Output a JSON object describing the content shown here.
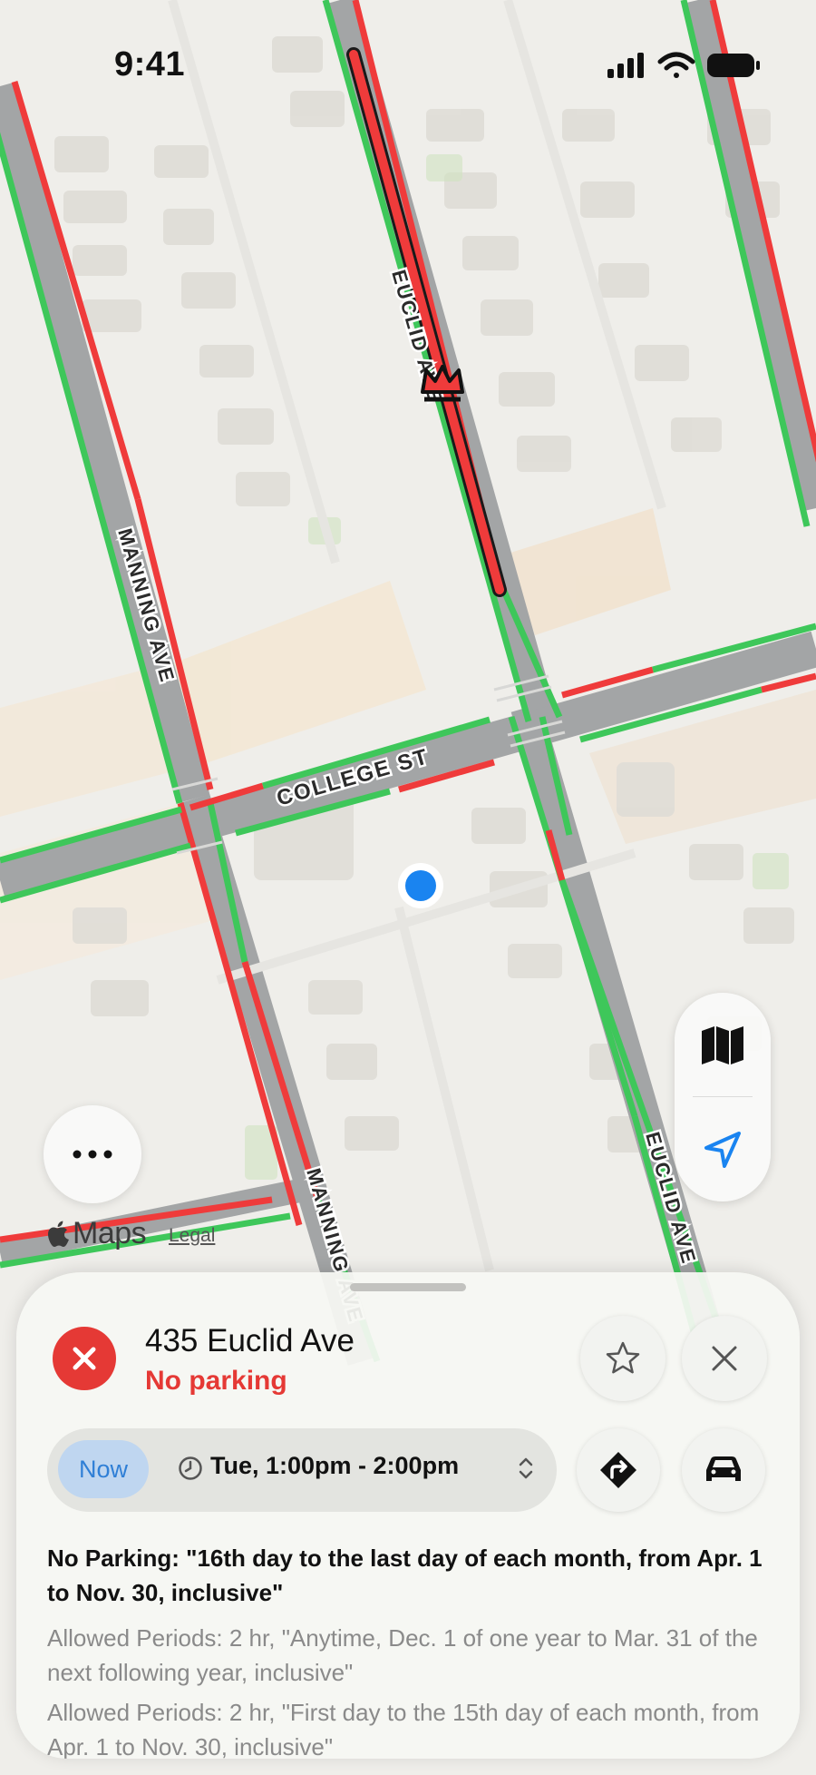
{
  "status_bar": {
    "time": "9:41"
  },
  "map": {
    "street_labels": [
      "EUCLID AVE",
      "MANNING AVE",
      "COLLEGE ST",
      "MANNING AVE",
      "EUCLID AVE"
    ],
    "attribution": {
      "brand": "Maps",
      "legal": "Legal"
    },
    "colors": {
      "allowed": "#3ec75a",
      "no_parking": "#ef3b3b",
      "road": "#a3a5a6",
      "user_location": "#1a84f0"
    }
  },
  "controls": {
    "more_icon": "ellipsis-icon",
    "map_mode_icon": "map-icon",
    "locate_icon": "location-arrow-icon"
  },
  "sheet": {
    "address": "435 Euclid Ave",
    "status": "No parking",
    "status_color": "#e53935",
    "now_label": "Now",
    "time_range": "Tue, 1:00pm - 2:00pm",
    "rules": {
      "no_parking": "No Parking: \"16th day to the last day of each month, from Apr. 1 to Nov. 30, inclusive\"",
      "allowed_1": "Allowed Periods: 2 hr, \"Anytime, Dec. 1 of one year to Mar. 31 of the next following year, inclusive\"",
      "allowed_2": "Allowed Periods: 2 hr, \"First day to the 15th day of each month, from Apr. 1 to Nov. 30, inclusive\""
    }
  }
}
